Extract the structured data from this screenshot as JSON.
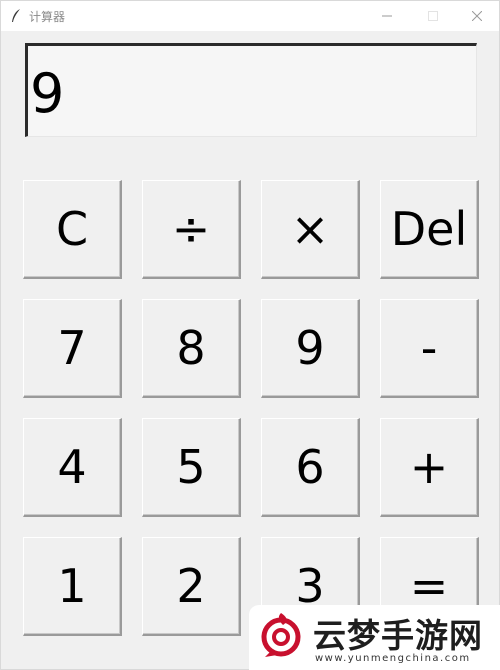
{
  "window": {
    "title": "计算器",
    "controls": {
      "minimize": "–",
      "maximize": "☐",
      "close": "✕"
    }
  },
  "display": {
    "value": "9"
  },
  "keypad": {
    "rows": [
      [
        "C",
        "÷",
        "×",
        "Del"
      ],
      [
        "7",
        "8",
        "9",
        "-"
      ],
      [
        "4",
        "5",
        "6",
        "+"
      ],
      [
        "1",
        "2",
        "3",
        "="
      ]
    ]
  },
  "watermark": {
    "brand": "云梦手游网",
    "url": "www.yunmengchina.com"
  }
}
